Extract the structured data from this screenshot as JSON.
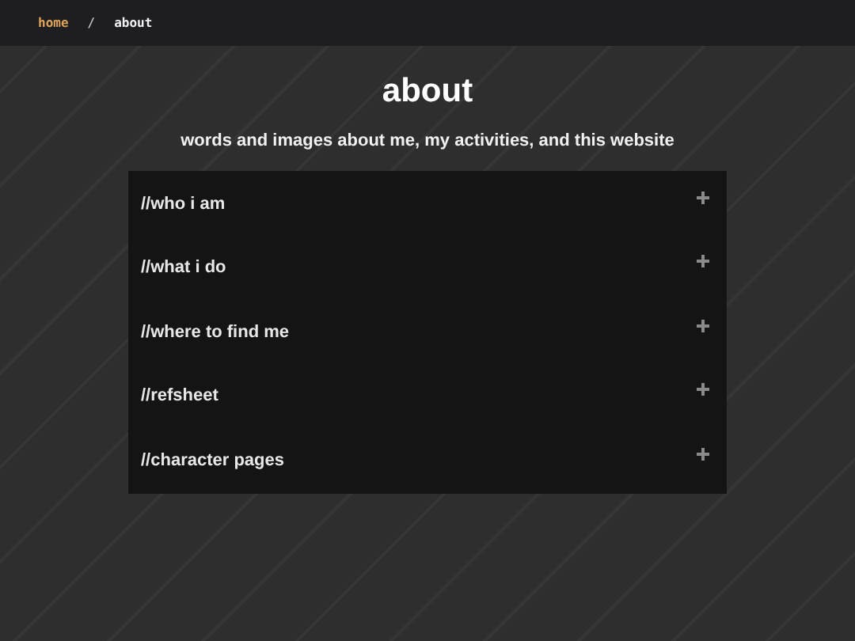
{
  "breadcrumb": [
    {
      "label": "home",
      "kind": "link"
    },
    {
      "label": "/",
      "kind": "separator"
    },
    {
      "label": "about",
      "kind": "current"
    }
  ],
  "title": "about",
  "subtitle": "words and images about me, my activities, and this website",
  "sections": [
    {
      "label": "//who i am",
      "expanded": false
    },
    {
      "label": "//what i do",
      "expanded": false
    },
    {
      "label": "//where to find me",
      "expanded": false
    },
    {
      "label": "//refsheet",
      "expanded": false
    },
    {
      "label": "//character pages",
      "expanded": false
    }
  ]
}
